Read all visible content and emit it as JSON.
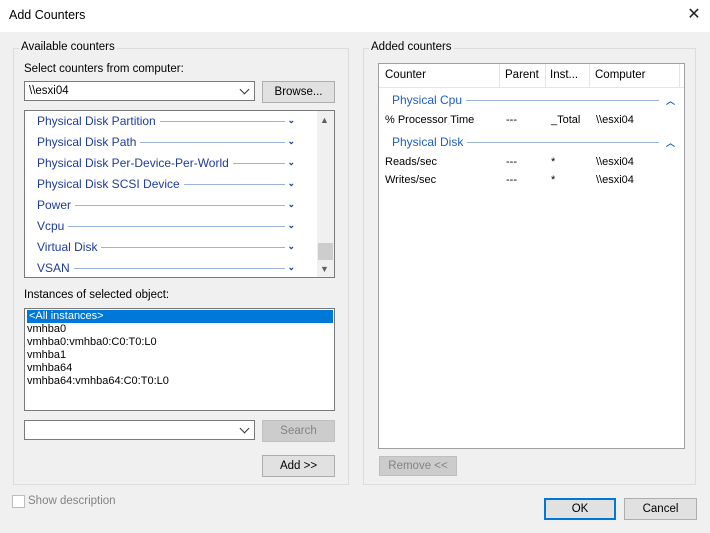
{
  "window": {
    "title": "Add Counters",
    "close_glyph": "✕"
  },
  "available": {
    "legend": "Available counters",
    "select_label": "Select counters from computer:",
    "computer_value": "\\\\esxi04",
    "browse_label": "Browse...",
    "counters": [
      "Physical Disk Partition",
      "Physical Disk Path",
      "Physical Disk Per-Device-Per-World",
      "Physical Disk SCSI Device",
      "Power",
      "Vcpu",
      "Virtual Disk",
      "VSAN"
    ],
    "instances_label": "Instances of selected object:",
    "instances": [
      "<All instances>",
      "vmhba0",
      "vmhba0:vmhba0:C0:T0:L0",
      "vmhba1",
      "vmhba64",
      "vmhba64:vmhba64:C0:T0:L0"
    ],
    "search_label": "Search",
    "add_label": "Add >>"
  },
  "added": {
    "legend": "Added counters",
    "columns": [
      "Counter",
      "Parent",
      "Inst...",
      "Computer"
    ],
    "groups": [
      {
        "name": "Physical Cpu",
        "rows": [
          {
            "counter": "% Processor Time",
            "parent": "---",
            "instance": "_Total",
            "computer": "\\\\esxi04"
          }
        ]
      },
      {
        "name": "Physical Disk",
        "rows": [
          {
            "counter": "Reads/sec",
            "parent": "---",
            "instance": "*",
            "computer": "\\\\esxi04"
          },
          {
            "counter": "Writes/sec",
            "parent": "---",
            "instance": "*",
            "computer": "\\\\esxi04"
          }
        ]
      }
    ],
    "remove_label": "Remove <<"
  },
  "footer": {
    "show_description_label": "Show description",
    "ok_label": "OK",
    "cancel_label": "Cancel"
  },
  "icons": {
    "chevron_down": "chevron-down-icon",
    "chevron_up": "chevron-up-icon",
    "close": "close-icon"
  },
  "colors": {
    "accent": "#0078d7",
    "link_blue": "#1f3c99",
    "group_blue": "#1f5fbf"
  }
}
